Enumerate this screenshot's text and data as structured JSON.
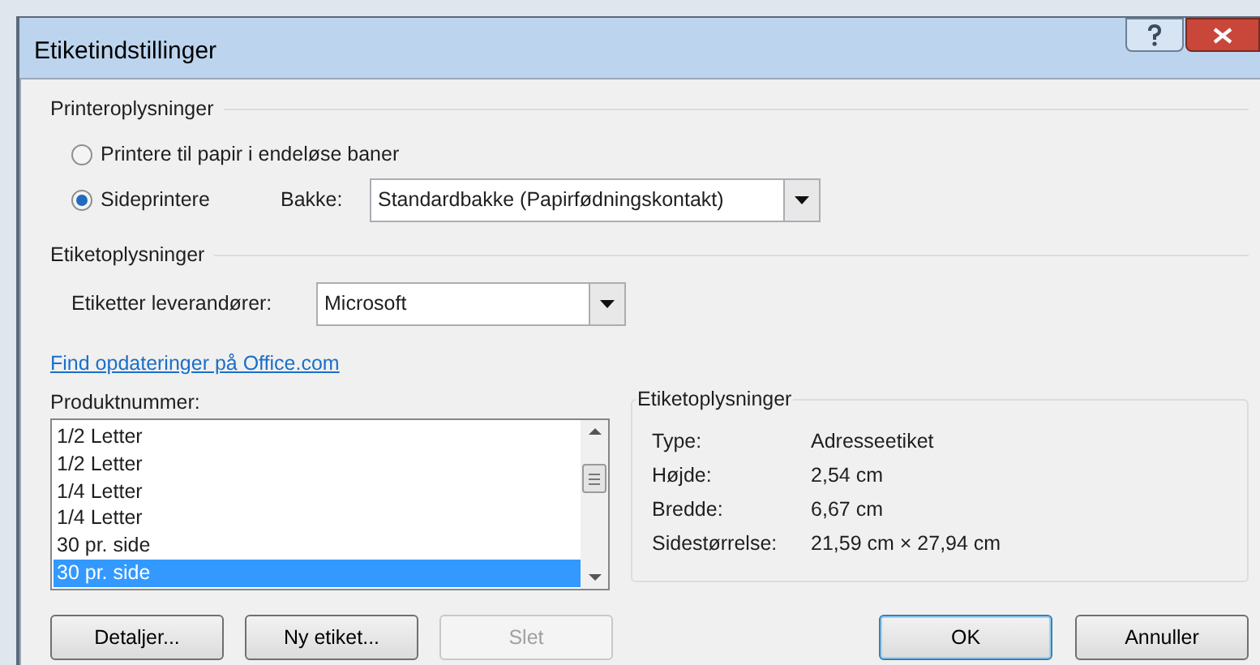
{
  "window": {
    "title": "Etiketindstillinger"
  },
  "printer_info": {
    "heading": "Printeroplysninger",
    "options": [
      {
        "label": "Printere til papir i endeløse baner",
        "selected": false
      },
      {
        "label": "Sideprintere",
        "selected": true
      }
    ],
    "tray": {
      "label": "Bakke:",
      "value": "Standardbakke (Papirfødningskontakt)"
    }
  },
  "label_info": {
    "heading": "Etiketoplysninger",
    "vendor": {
      "label": "Etiketter leverandører:",
      "value": "Microsoft"
    },
    "link": "Find opdateringer på Office.com",
    "products": {
      "label": "Produktnummer:",
      "items": [
        {
          "label": "1/2 Letter",
          "selected": false
        },
        {
          "label": "1/2 Letter",
          "selected": false
        },
        {
          "label": "1/4 Letter",
          "selected": false
        },
        {
          "label": "1/4 Letter",
          "selected": false
        },
        {
          "label": "30 pr. side",
          "selected": false
        },
        {
          "label": "30 pr. side",
          "selected": true
        }
      ]
    }
  },
  "details": {
    "heading": "Etiketoplysninger",
    "rows": [
      {
        "label": "Type:",
        "value": "Adresseetiket"
      },
      {
        "label": "Højde:",
        "value": "2,54 cm"
      },
      {
        "label": "Bredde:",
        "value": "6,67 cm"
      },
      {
        "label": "Sidestørrelse:",
        "value": "21,59 cm × 27,94 cm"
      }
    ]
  },
  "buttons_left": [
    {
      "label": "Detaljer...",
      "disabled": false,
      "default": false
    },
    {
      "label": "Ny etiket...",
      "disabled": false,
      "default": false
    },
    {
      "label": "Slet",
      "disabled": true,
      "default": false
    }
  ],
  "buttons_right": [
    {
      "label": "OK",
      "disabled": false,
      "default": true
    },
    {
      "label": "Annuller",
      "disabled": false,
      "default": false
    }
  ]
}
